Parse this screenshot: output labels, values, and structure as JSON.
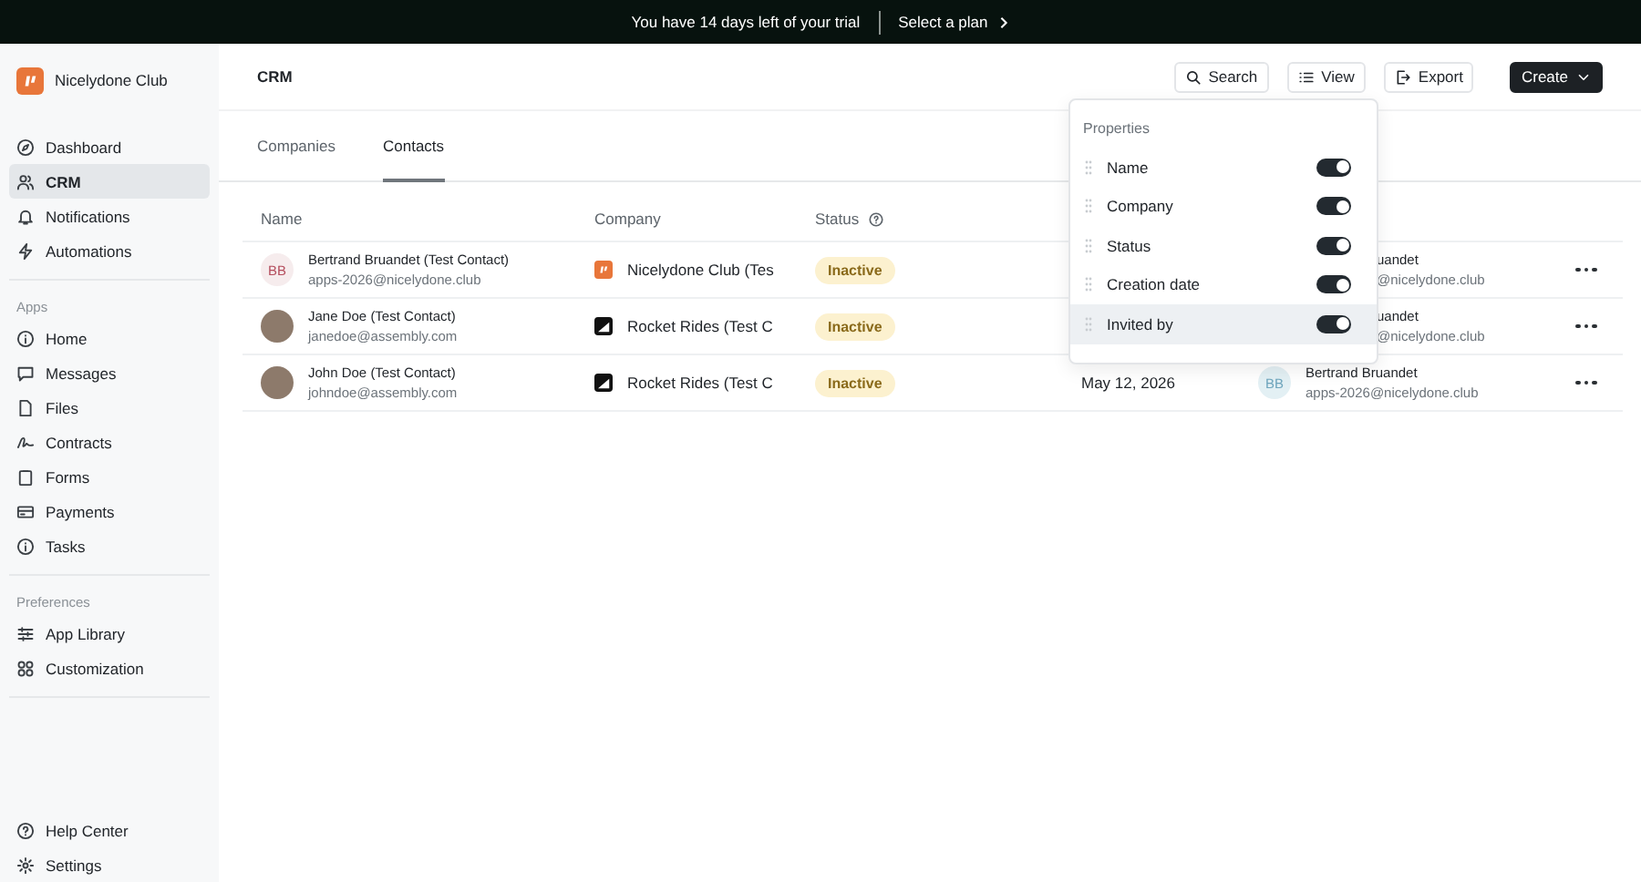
{
  "banner": {
    "message": "You have 14 days left of your trial",
    "link": "Select a plan"
  },
  "sidebar": {
    "brand": "Nicelydone Club",
    "groups": [
      {
        "items": [
          {
            "label": "Dashboard",
            "selected": false
          },
          {
            "label": "CRM",
            "selected": true
          },
          {
            "label": "Notifications",
            "selected": false
          },
          {
            "label": "Automations",
            "selected": false
          }
        ]
      },
      {
        "title": "Apps",
        "items": [
          {
            "label": "Home",
            "selected": false
          },
          {
            "label": "Messages",
            "selected": false
          },
          {
            "label": "Files",
            "selected": false
          },
          {
            "label": "Contracts",
            "selected": false
          },
          {
            "label": "Forms",
            "selected": false
          },
          {
            "label": "Payments",
            "selected": false
          },
          {
            "label": "Tasks",
            "selected": false
          }
        ]
      },
      {
        "title": "Preferences",
        "items": [
          {
            "label": "App Library",
            "selected": false
          },
          {
            "label": "Customization",
            "selected": false
          }
        ]
      }
    ],
    "footer": [
      {
        "label": "Help Center"
      },
      {
        "label": "Settings"
      }
    ]
  },
  "header": {
    "title": "CRM",
    "buttons": [
      {
        "label": "Search",
        "kind": "search"
      },
      {
        "label": "View",
        "kind": "view"
      },
      {
        "label": "Export",
        "kind": "export"
      },
      {
        "label": "Create",
        "kind": "primary"
      }
    ]
  },
  "tabs": [
    {
      "label": "Companies",
      "selected": false
    },
    {
      "label": "Contacts",
      "selected": true
    }
  ],
  "table": {
    "columns": [
      {
        "label": "Name"
      },
      {
        "label": "Company"
      },
      {
        "label": "Status",
        "help": true
      }
    ],
    "rows": [
      {
        "avatar": {
          "kind": "initials",
          "initials": "BB"
        },
        "name": "Bertrand Bruandet (Test Contact)",
        "email": "apps-2026@nicelydone.club",
        "company": {
          "name": "Nicelydone Club (Tes",
          "kind": "club"
        },
        "status": "Inactive",
        "invited_by": {
          "name": "uandet",
          "email": "@nicelydone.club"
        }
      },
      {
        "avatar": {
          "kind": "photo"
        },
        "name": "Jane Doe (Test Contact)",
        "email": "janedoe@assembly.com",
        "company": {
          "name": "Rocket Rides (Test C",
          "kind": "rocket"
        },
        "status": "Inactive",
        "invited_by": {
          "name": "uandet",
          "email": "@nicelydone.club"
        }
      },
      {
        "avatar": {
          "kind": "photo"
        },
        "name": "John Doe (Test Contact)",
        "email": "johndoe@assembly.com",
        "company": {
          "name": "Rocket Rides (Test C",
          "kind": "rocket"
        },
        "status": "Inactive",
        "created": "May 12, 2026",
        "invited_by": {
          "initials": "BB",
          "name": "Bertrand Bruandet",
          "email": "apps-2026@nicelydone.club"
        }
      }
    ]
  },
  "properties_menu": {
    "title": "Properties",
    "items": [
      {
        "label": "Name",
        "on": true,
        "hovered": false
      },
      {
        "label": "Company",
        "on": true,
        "hovered": false
      },
      {
        "label": "Status",
        "on": true,
        "hovered": false
      },
      {
        "label": "Creation date",
        "on": true,
        "hovered": false
      },
      {
        "label": "Invited by",
        "on": true,
        "hovered": true
      }
    ]
  }
}
